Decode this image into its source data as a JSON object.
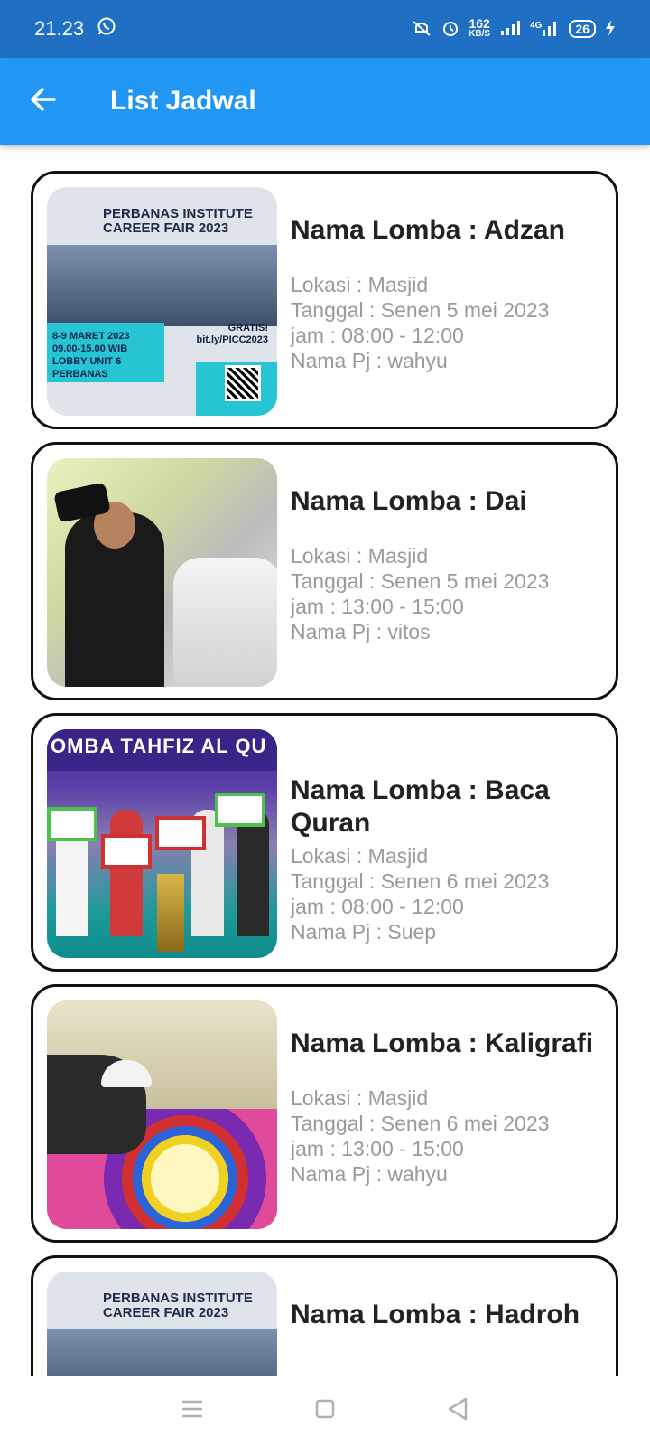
{
  "status_bar": {
    "time": "21.23",
    "net_speed": "162",
    "net_unit": "KB/S",
    "network": "4G",
    "battery": "26"
  },
  "app_bar": {
    "title": "List Jadwal"
  },
  "poster": {
    "header_line1": "PERBANAS INSTITUTE",
    "header_line2": "CAREER FAIR 2023",
    "date_line1": "8-9 MARET 2023",
    "date_line2": "09.00-15.00 WIB",
    "date_line3": "LOBBY UNIT 6 PERBANAS",
    "gratis": "GRATIS!",
    "link": "bit.ly/PICC2023"
  },
  "photo_quran": {
    "banner": "OMBA TAHFIZ AL QU"
  },
  "items": [
    {
      "name": "Nama Lomba : Adzan",
      "lokasi": "Lokasi : Masjid",
      "tanggal": "Tanggal : Senen 5 mei 2023",
      "jam": "jam : 08:00 - 12:00",
      "pj": "Nama Pj : wahyu"
    },
    {
      "name": "Nama Lomba : Dai",
      "lokasi": "Lokasi : Masjid",
      "tanggal": "Tanggal : Senen 5 mei 2023",
      "jam": "jam : 13:00 - 15:00",
      "pj": "Nama Pj : vitos"
    },
    {
      "name": "Nama Lomba : Baca Quran",
      "lokasi": "Lokasi : Masjid",
      "tanggal": "Tanggal : Senen 6 mei 2023",
      "jam": "jam : 08:00 - 12:00",
      "pj": "Nama Pj : Suep"
    },
    {
      "name": "Nama Lomba : Kaligrafi",
      "lokasi": "Lokasi : Masjid",
      "tanggal": "Tanggal : Senen 6 mei 2023",
      "jam": "jam : 13:00 - 15:00",
      "pj": "Nama Pj : wahyu"
    },
    {
      "name": "Nama Lomba : Hadroh"
    }
  ],
  "colors": {
    "status_bar": "#1f6fc2",
    "app_bar": "#2196f3",
    "card_border": "#111111",
    "detail_text": "#9a9a9a"
  }
}
